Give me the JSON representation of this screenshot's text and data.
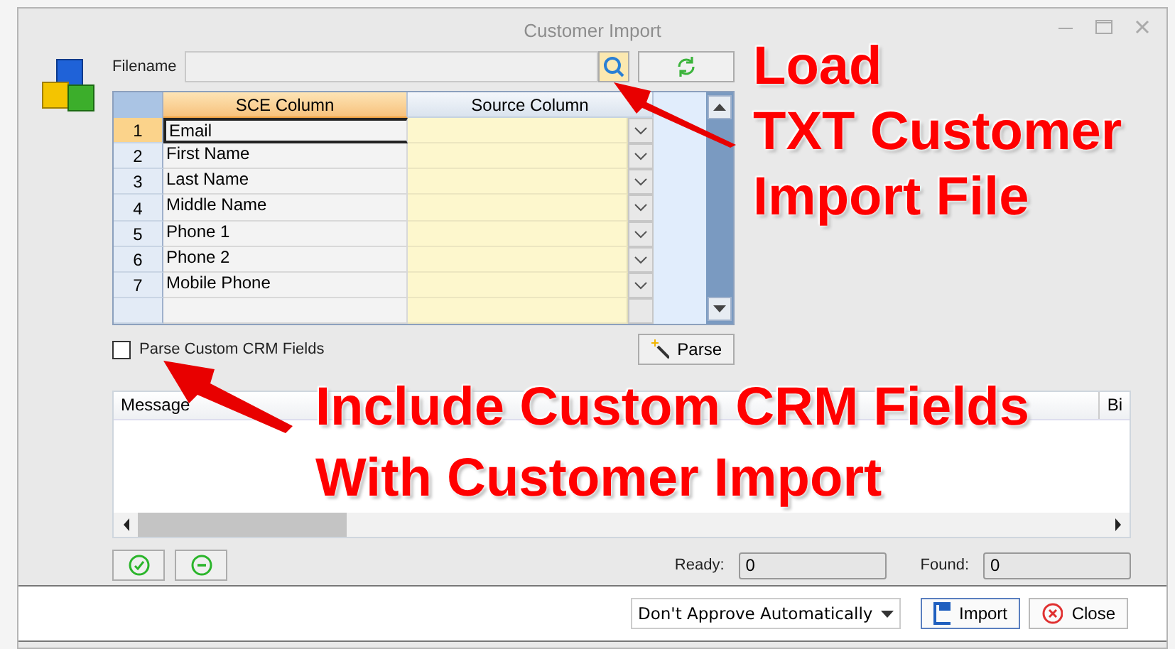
{
  "window": {
    "title": "Customer Import"
  },
  "filename": {
    "label": "Filename"
  },
  "grid": {
    "columns": [
      "SCE Column",
      "Source Column"
    ],
    "rows": [
      {
        "number": "1",
        "name": "Email",
        "selected": true
      },
      {
        "number": "2",
        "name": "First Name",
        "selected": false
      },
      {
        "number": "3",
        "name": "Last Name",
        "selected": false
      },
      {
        "number": "4",
        "name": "Middle Name",
        "selected": false
      },
      {
        "number": "5",
        "name": "Phone 1",
        "selected": false
      },
      {
        "number": "6",
        "name": "Phone 2",
        "selected": false
      },
      {
        "number": "7",
        "name": "Mobile Phone",
        "selected": false
      }
    ]
  },
  "parse_custom": {
    "label": "Parse Custom CRM Fields",
    "checked": false
  },
  "parse_button": "Parse",
  "messages": {
    "columns": [
      "Message",
      "Bi"
    ]
  },
  "counts": [
    {
      "label": "Ready:",
      "value": "0"
    },
    {
      "label": "Found:",
      "value": "0"
    }
  ],
  "approve_select": "Don't Approve Automatically",
  "buttons": [
    "Import",
    "Close"
  ],
  "annotations": [
    {
      "lines": [
        "Load",
        "TXT Customer",
        "Import File"
      ]
    },
    {
      "lines": [
        "Include Custom CRM Fields",
        "With Customer Import"
      ]
    }
  ]
}
